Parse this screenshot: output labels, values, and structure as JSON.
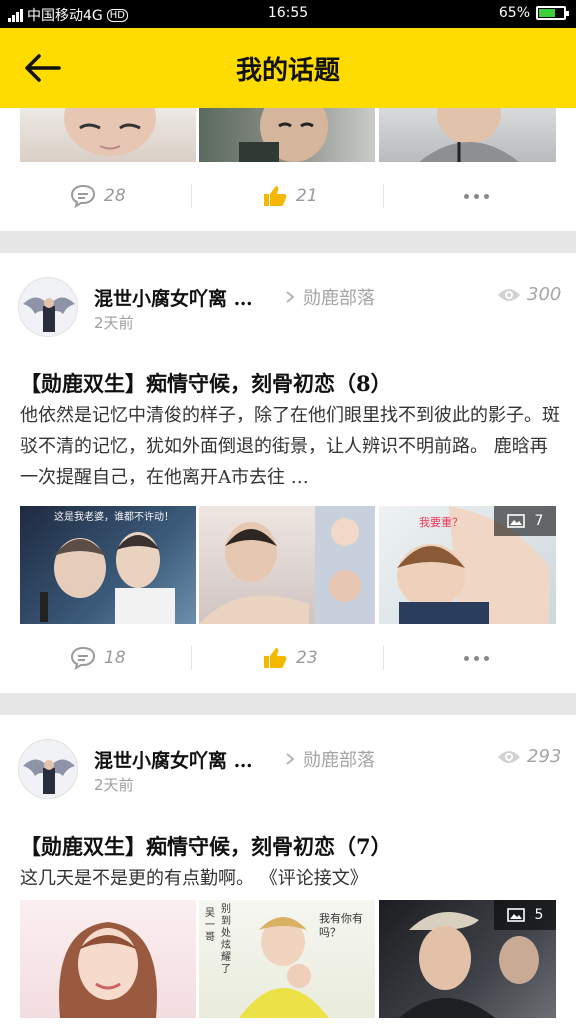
{
  "status": {
    "carrier": "中国移动4G",
    "hd": "HD",
    "time": "16:55",
    "battery": "65%",
    "battery_level": 0.65
  },
  "header": {
    "title": "我的话题"
  },
  "prev_post": {
    "comments": "28",
    "likes": "21"
  },
  "posts": [
    {
      "author": "混世小腐女吖离 …",
      "date": "2天前",
      "tribe": "勋鹿部落",
      "views": "300",
      "title": "【勋鹿双生】痴情守候，刻骨初恋（8）",
      "body": "他依然是记忆中清俊的样子，除了在他们眼里找不到彼此的影子。斑驳不清的记忆，犹如外面倒退的街景，让人辨识不明前路。 鹿晗再一次提醒自己，在他离开A市去往 …",
      "photo1_caption": "这是我老婆，谁都不许动！",
      "photo3_caption": "我要重？",
      "image_count": "7",
      "comments": "18",
      "likes": "23"
    },
    {
      "author": "混世小腐女吖离 …",
      "date": "2天前",
      "tribe": "勋鹿部落",
      "views": "293",
      "title": "【勋鹿双生】痴情守候，刻骨初恋（7）",
      "body": "这几天是不是更的有点勤啊。 《评论接文》",
      "photo2_caption_a": "吴一哥",
      "photo2_caption_b": "别到处炫耀了",
      "photo2_caption_c": "我有你有吗？",
      "image_count": "5"
    }
  ],
  "colors": {
    "accent": "#ffdc00",
    "like_icon": "#f5b800",
    "background_gap": "#e6e6e6"
  }
}
